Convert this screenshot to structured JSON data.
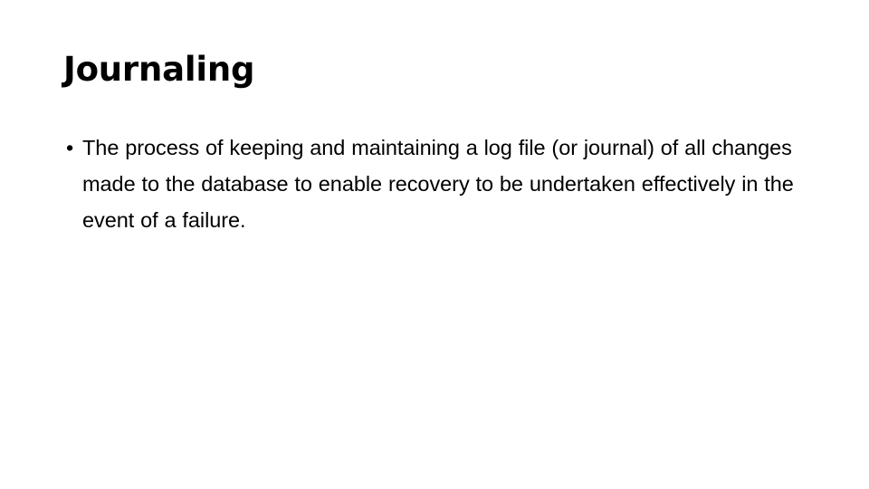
{
  "slide": {
    "background_color": "#ffffff",
    "text_color": "#000000",
    "title": "Journaling",
    "bullets": [
      {
        "marker": "•",
        "text": "The process of keeping and maintaining a log file (or journal) of all changes made to the database to enable recovery to be undertaken effectively in the event of a failure."
      }
    ]
  }
}
